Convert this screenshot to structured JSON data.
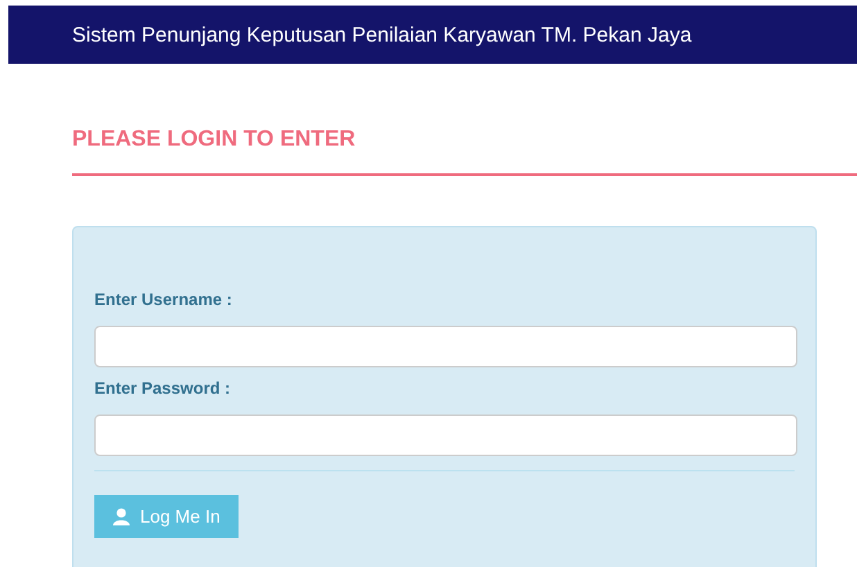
{
  "header": {
    "title": "Sistem Penunjang Keputusan Penilaian Karyawan TM. Pekan Jaya"
  },
  "heading": "PLEASE LOGIN TO ENTER",
  "fields": [
    {
      "label": "Enter Username :"
    },
    {
      "label": "Enter Password :"
    }
  ],
  "button": {
    "label": "Log Me In"
  }
}
